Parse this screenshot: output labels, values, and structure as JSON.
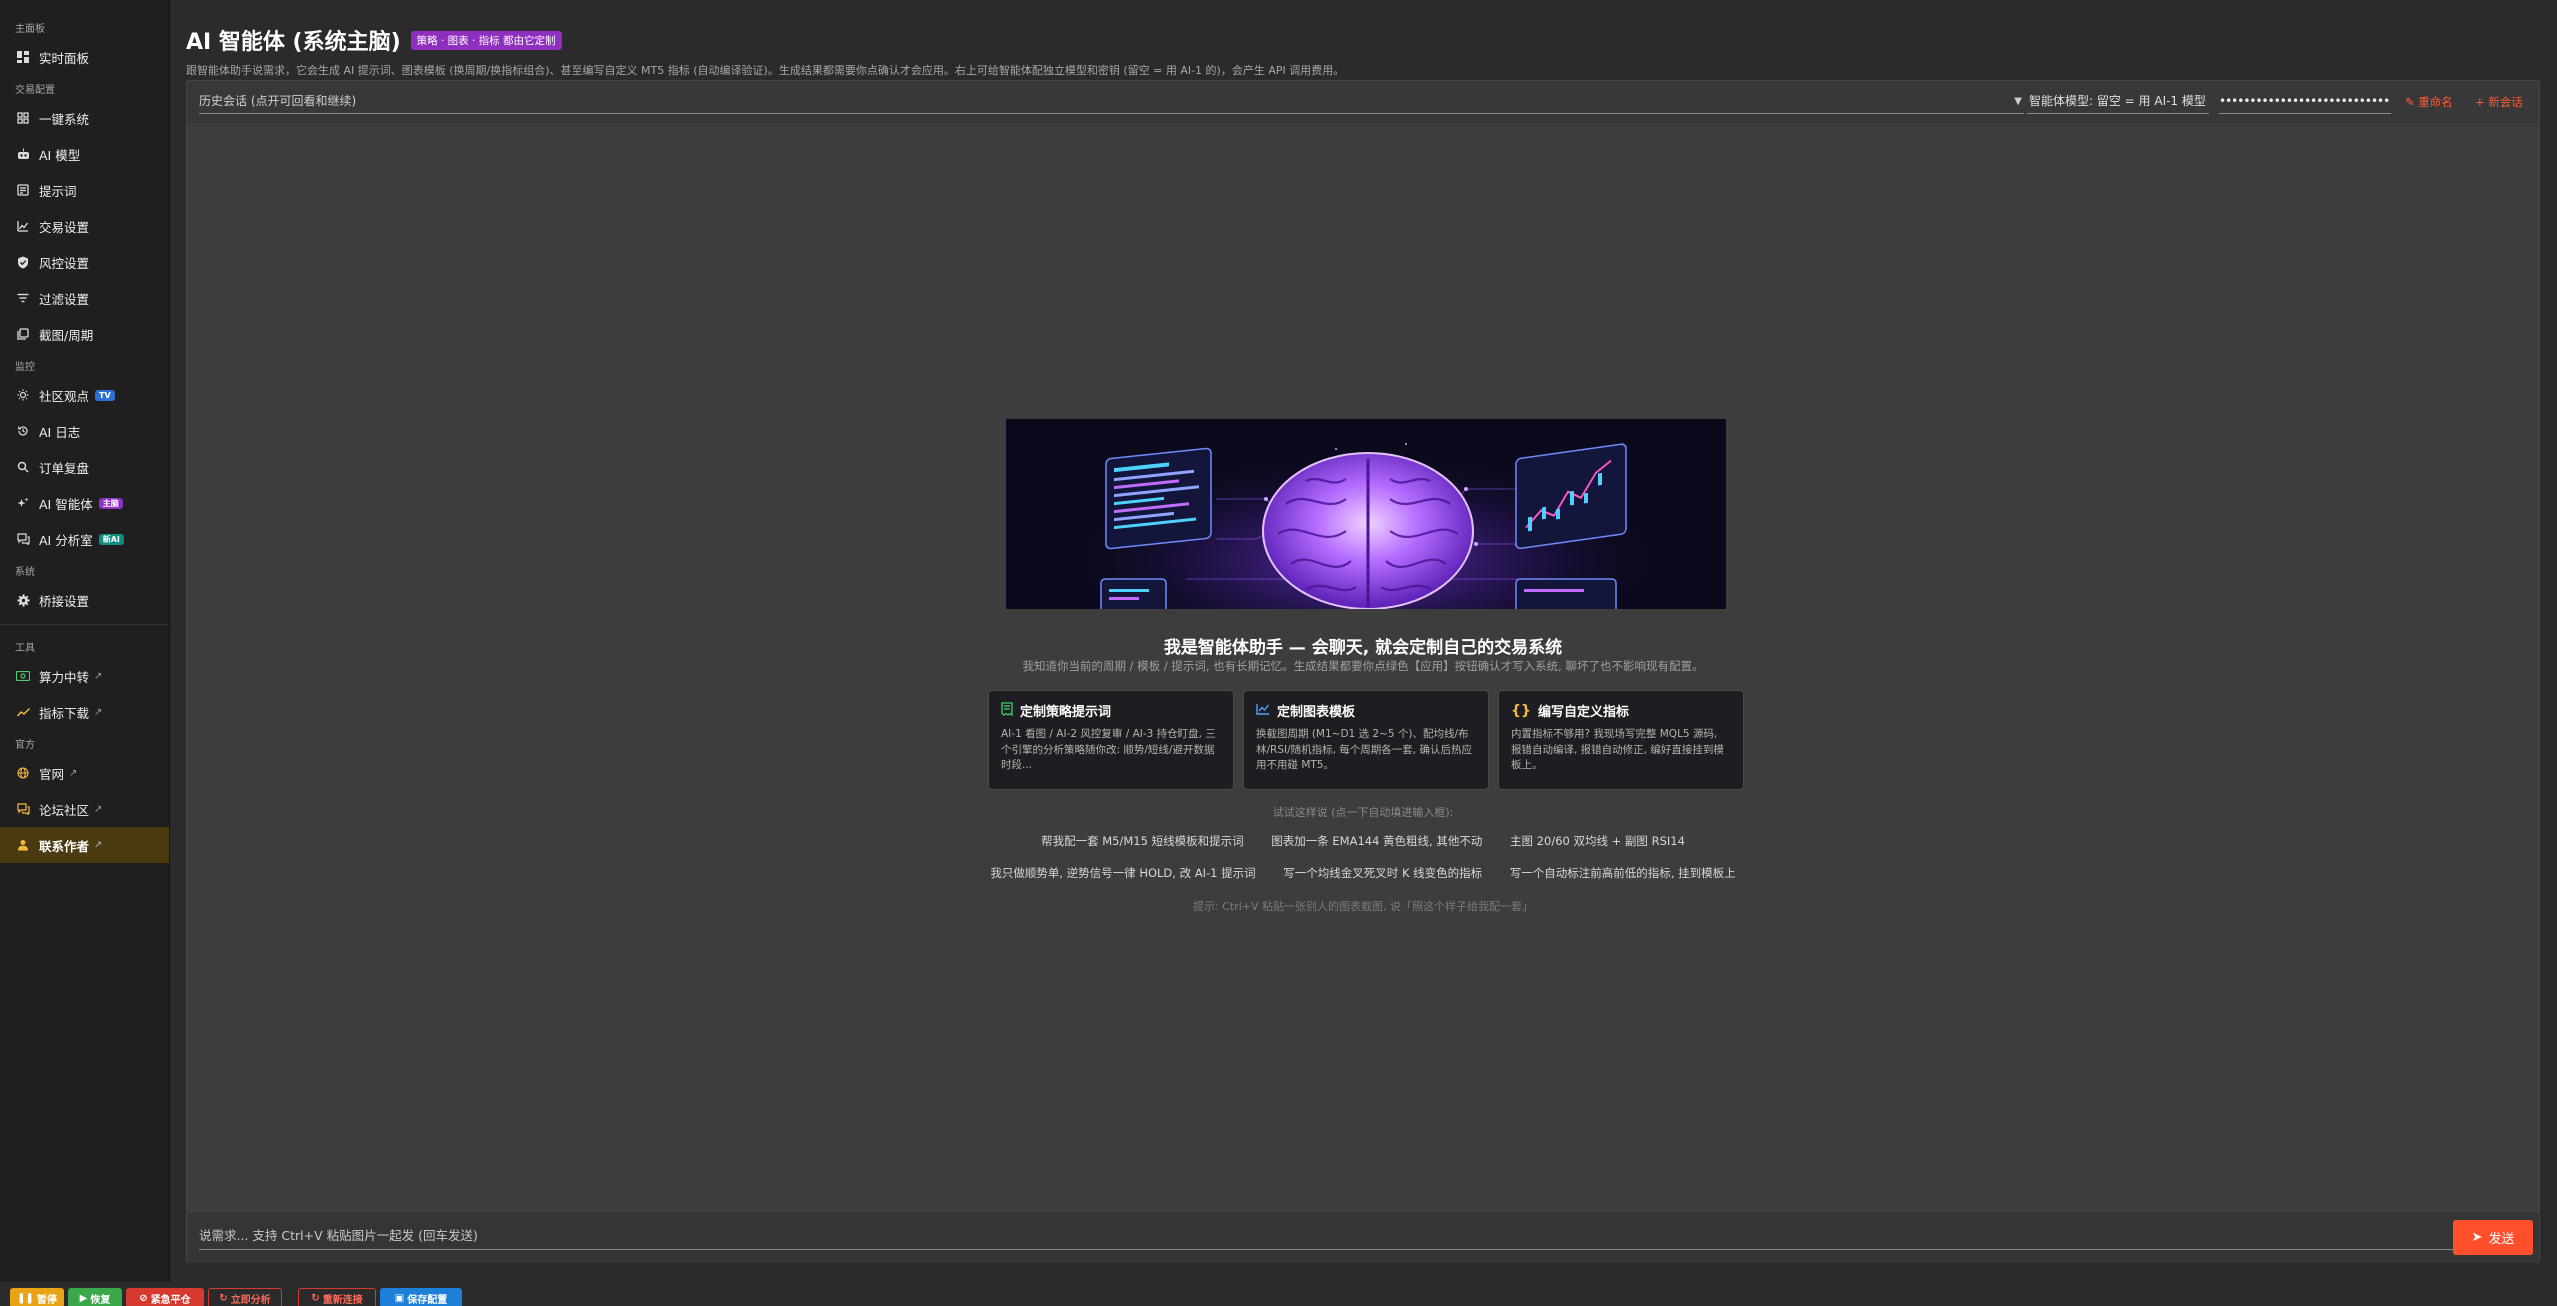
{
  "sidebar": {
    "sections": {
      "main": "主面板",
      "trading": "交易配置",
      "monitor": "监控",
      "system": "系统",
      "tools": "工具",
      "official": "官方"
    },
    "items": [
      {
        "label": "实时面板",
        "icon": "dashboard-icon"
      },
      {
        "label": "一键系统",
        "icon": "grid-icon"
      },
      {
        "label": "AI 模型",
        "icon": "robot-icon"
      },
      {
        "label": "提示词",
        "icon": "note-icon"
      },
      {
        "label": "交易设置",
        "icon": "chart-line-icon"
      },
      {
        "label": "风控设置",
        "icon": "shield-icon"
      },
      {
        "label": "过滤设置",
        "icon": "filter-icon"
      },
      {
        "label": "截图/周期",
        "icon": "layers-icon"
      },
      {
        "label": "社区观点",
        "icon": "bulb-icon",
        "badge": "TV"
      },
      {
        "label": "AI 日志",
        "icon": "history-icon"
      },
      {
        "label": "订单复盘",
        "icon": "search-icon"
      },
      {
        "label": "AI 智能体",
        "icon": "sparkle-icon",
        "badge": "主脑"
      },
      {
        "label": "AI 分析室",
        "icon": "chat-icon",
        "badge": "新AI"
      },
      {
        "label": "桥接设置",
        "icon": "gear-icon"
      },
      {
        "label": "算力中转",
        "icon": "money-icon"
      },
      {
        "label": "指标下载",
        "icon": "trend-icon"
      },
      {
        "label": "官网",
        "icon": "globe-icon"
      },
      {
        "label": "论坛社区",
        "icon": "forum-icon"
      },
      {
        "label": "联系作者",
        "icon": "person-icon"
      }
    ],
    "external_mark": "↗"
  },
  "header": {
    "title": "AI 智能体 (系统主脑)",
    "tag": "策略 · 图表 · 指标 都由它定制",
    "subtitle": "跟智能体助手说需求，它会生成 AI 提示词、图表模板 (换周期/换指标组合)、甚至编写自定义 MT5 指标 (自动编译验证)。生成结果都需要你点确认才会应用。右上可给智能体配独立模型和密钥 (留空 = 用 AI-1 的)，会产生 API 调用费用。"
  },
  "topbar": {
    "history_placeholder": "历史会话 (点开可回看和继续)",
    "model_placeholder": "智能体模型: 留空 = 用 AI-1 模型",
    "api_key_masked": "••••••••••••••••••••••••••••••••",
    "rename_label": "重命名",
    "new_chat_label": "+ 新会话",
    "accent_color": "#ff5a36"
  },
  "welcome": {
    "title": "我是智能体助手 — 会聊天, 就会定制自己的交易系统",
    "subtitle": "我知道你当前的周期 / 模板 / 提示词, 也有长期记忆。生成结果都要你点绿色【应用】按钮确认才写入系统, 聊坏了也不影响现有配置。"
  },
  "cards": [
    {
      "icon": "receipt-icon",
      "icon_color": "#3ecf6e",
      "title": "定制策略提示词",
      "body": "AI-1 看图 / AI-2 风控复审 / AI-3 持仓盯盘, 三个引擎的分析策略随你改: 顺势/短线/避开数据时段..."
    },
    {
      "icon": "chart-line-icon",
      "icon_color": "#4da3ff",
      "title": "定制图表模板",
      "body": "换截图周期 (M1~D1 选 2~5 个)、配均线/布林/RSI/随机指标, 每个周期各一套, 确认后热应用不用碰 MT5。"
    },
    {
      "icon": "braces-icon",
      "icon_color": "#f5b942",
      "title": "编写自定义指标",
      "body": "内置指标不够用? 我现场写完整 MQL5 源码, 报错自动编译, 报错自动修正, 编好直接挂到模板上。"
    }
  ],
  "examples": {
    "label": "试试这样说 (点一下自动填进输入框):",
    "row1": [
      "帮我配一套 M5/M15 短线模板和提示词",
      "图表加一条 EMA144 黄色粗线, 其他不动",
      "主图 20/60 双均线 + 副图 RSI14"
    ],
    "row2": [
      "我只做顺势单, 逆势信号一律 HOLD, 改 AI-1 提示词",
      "写一个均线金叉死叉时 K 线变色的指标",
      "写一个自动标注前高前低的指标, 挂到模板上"
    ],
    "tip": "提示: Ctrl+V 粘贴一张别人的图表截图, 说「照这个样子给我配一套」"
  },
  "composer": {
    "placeholder": "说需求... 支持 Ctrl+V 粘贴图片一起发 (回车发送)",
    "send_label": "发送",
    "send_color": "#ff4f2b"
  },
  "bottombar": {
    "buttons": [
      {
        "label": "暂停",
        "color": "#e8a317"
      },
      {
        "label": "恢复",
        "color": "#3aa84a"
      },
      {
        "label": "紧急平仓",
        "color": "#d63a2f"
      },
      {
        "label": "立即分析",
        "color": "#d63a2f"
      },
      {
        "label": "重新连接",
        "color": "#d63a2f"
      },
      {
        "label": "保存配置",
        "color": "#1e7fd8"
      }
    ]
  }
}
